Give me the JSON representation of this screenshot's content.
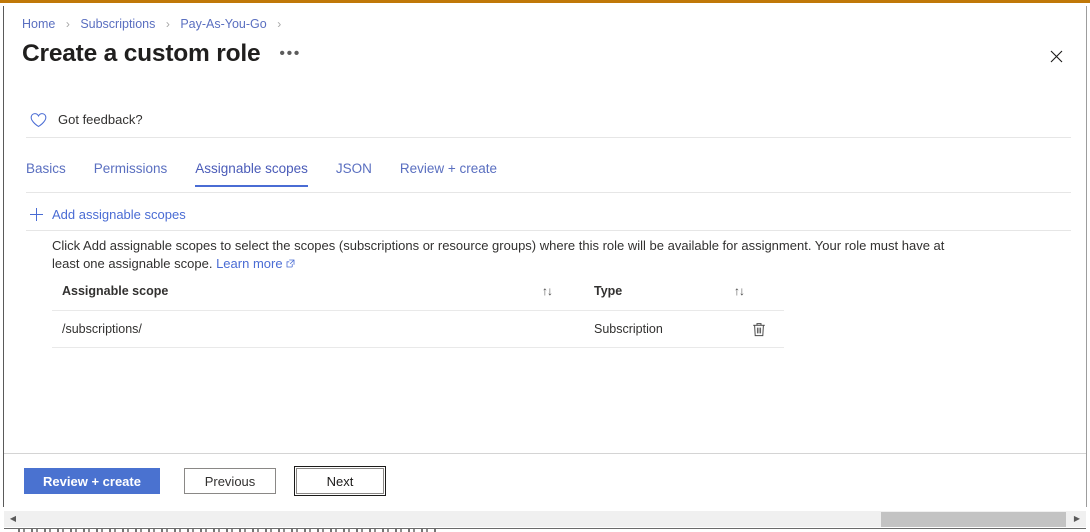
{
  "window": {
    "accent_top_color": "#c07808",
    "close_icon": "close-icon"
  },
  "breadcrumb": {
    "items": [
      {
        "label": "Home"
      },
      {
        "label": "Subscriptions"
      },
      {
        "label": "Pay-As-You-Go"
      }
    ],
    "separator": "›"
  },
  "header": {
    "title": "Create a custom role",
    "more_label": "•••",
    "close_label": "✕"
  },
  "feedback": {
    "label": "Got feedback?",
    "icon": "heart-icon"
  },
  "tabs": [
    {
      "label": "Basics",
      "active": false
    },
    {
      "label": "Permissions",
      "active": false
    },
    {
      "label": "Assignable scopes",
      "active": true
    },
    {
      "label": "JSON",
      "active": false
    },
    {
      "label": "Review + create",
      "active": false
    }
  ],
  "command_bar": {
    "add_scopes_label": "Add assignable scopes",
    "add_icon": "plus-icon"
  },
  "description": {
    "text": "Click Add assignable scopes to select the scopes (subscriptions or resource groups) where this role will be available for assignment. Your role must have at least one assignable scope.",
    "learn_more_label": "Learn more",
    "external_icon": "external-link-icon"
  },
  "table": {
    "columns": [
      {
        "key": "scope",
        "label": "Assignable scope",
        "sortable": true
      },
      {
        "key": "type",
        "label": "Type",
        "sortable": true
      }
    ],
    "sort_icon": "↑↓",
    "rows": [
      {
        "scope": "/subscriptions/",
        "type": "Subscription",
        "delete_icon": "trash-icon"
      }
    ]
  },
  "footer": {
    "review_create_label": "Review + create",
    "previous_label": "Previous",
    "next_label": "Next",
    "primary_color": "#4a72d0"
  },
  "scrollbar": {
    "left_arrow": "◀",
    "right_arrow": "▶",
    "orientation": "horizontal"
  }
}
